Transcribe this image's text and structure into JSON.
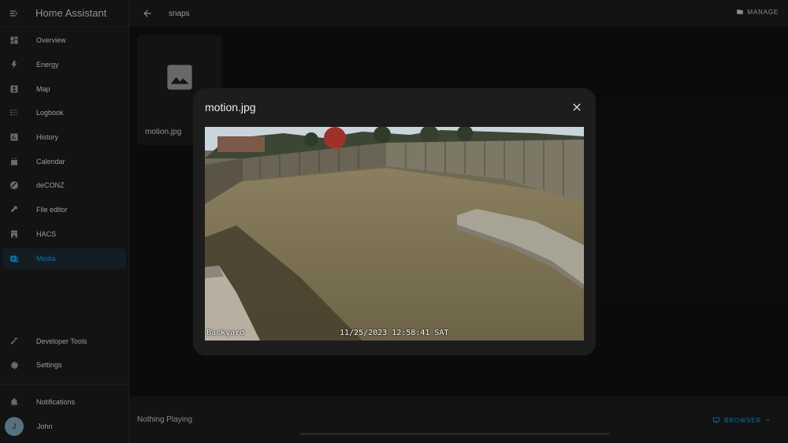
{
  "app": {
    "title": "Home Assistant"
  },
  "sidebar": {
    "items": [
      {
        "label": "Overview",
        "icon": "overview-icon"
      },
      {
        "label": "Energy",
        "icon": "energy-icon"
      },
      {
        "label": "Map",
        "icon": "map-icon"
      },
      {
        "label": "Logbook",
        "icon": "logbook-icon"
      },
      {
        "label": "History",
        "icon": "history-icon"
      },
      {
        "label": "Calendar",
        "icon": "calendar-icon"
      },
      {
        "label": "deCONZ",
        "icon": "deconz-icon"
      },
      {
        "label": "File editor",
        "icon": "file-editor-icon"
      },
      {
        "label": "HACS",
        "icon": "hacs-icon"
      },
      {
        "label": "Media",
        "icon": "media-icon",
        "active": true
      }
    ],
    "developer_tools": "Developer Tools",
    "settings": "Settings",
    "notifications": "Notifications",
    "user": {
      "name": "John",
      "initial": "J"
    }
  },
  "topbar": {
    "breadcrumb": "snaps",
    "manage_label": "MANAGE"
  },
  "media": {
    "items": [
      {
        "label": "motion.jpg",
        "icon": "image-placeholder-icon"
      }
    ]
  },
  "player": {
    "status": "Nothing Playing",
    "browser_label": "BROWSER"
  },
  "dialog": {
    "title": "motion.jpg",
    "overlay_camera": "Backyard",
    "overlay_timestamp": "11/25/2023 12:58:41 SAT"
  },
  "colors": {
    "accent": "#03a9f4",
    "sidebar_bg": "#1c1c1c",
    "page_bg": "#111111",
    "dialog_bg": "#1d1d1d"
  }
}
